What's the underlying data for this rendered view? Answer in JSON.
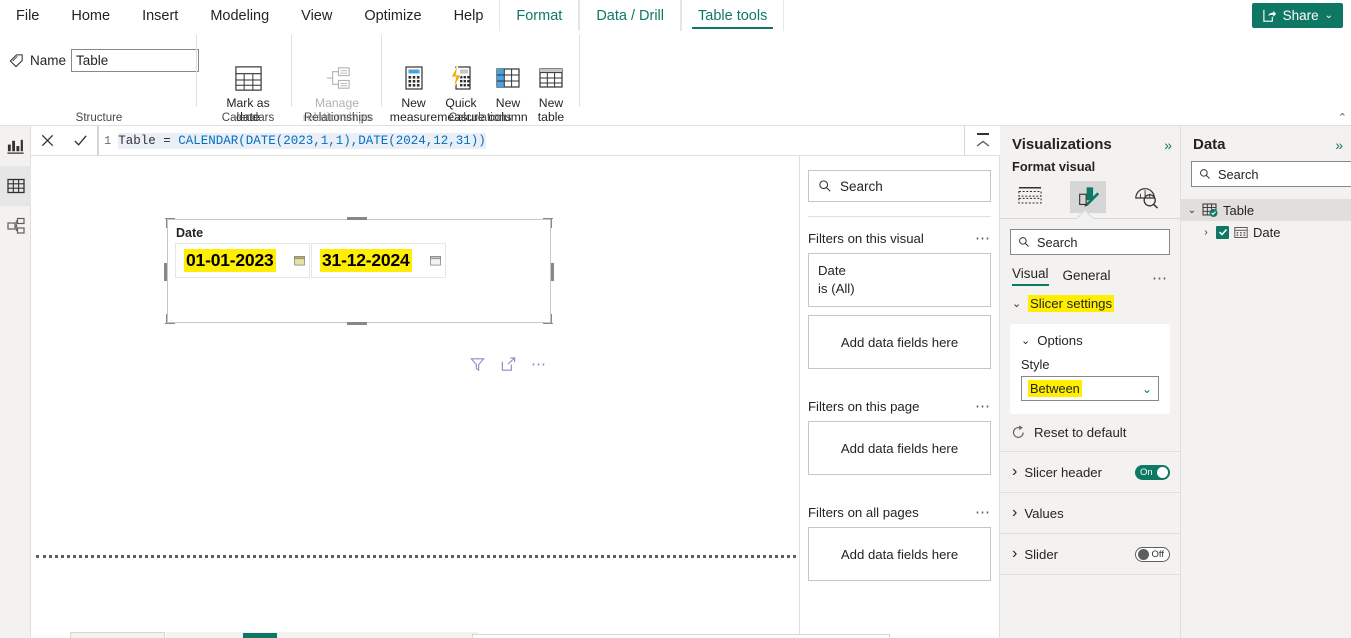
{
  "ribbon": {
    "tabs": [
      {
        "label": "File",
        "type": "normal",
        "active": false
      },
      {
        "label": "Home",
        "type": "normal",
        "active": false
      },
      {
        "label": "Insert",
        "type": "normal",
        "active": false
      },
      {
        "label": "Modeling",
        "type": "normal",
        "active": false
      },
      {
        "label": "View",
        "type": "normal",
        "active": false
      },
      {
        "label": "Optimize",
        "type": "normal",
        "active": false
      },
      {
        "label": "Help",
        "type": "normal",
        "active": false
      },
      {
        "label": "Format",
        "type": "contextual",
        "active": false
      },
      {
        "label": "Data / Drill",
        "type": "contextual",
        "active": false
      },
      {
        "label": "Table tools",
        "type": "contextual",
        "active": true
      }
    ],
    "share_label": "Share",
    "share_color": "#0f7864",
    "name_label": "Name",
    "name_value": "Table",
    "buttons": {
      "mark_as_date_table": "Mark as date\ntable ⌄",
      "manage_relationships": "Manage\nrelationships",
      "new_measure": "New\nmeasure",
      "quick_measure": "Quick\nmeasure",
      "new_column": "New\ncolumn",
      "new_table": "New\ntable"
    },
    "groups": {
      "structure": "Structure",
      "calendars": "Calendars",
      "relationships": "Relationships",
      "calculations": "Calculations"
    }
  },
  "formula_bar": {
    "line_number": "1",
    "name": "Table",
    "equals": " = ",
    "expression": "CALENDAR(DATE(2023,1,1),DATE(2024,12,31))",
    "full_text": "Table = CALENDAR(DATE(2023,1,1),DATE(2024,12,31))"
  },
  "canvas": {
    "slicer": {
      "title": "Date",
      "start_value": "01-01-2023",
      "end_value": "31-12-2024",
      "highlight_color": "#ffee00"
    }
  },
  "filters": {
    "search_placeholder": "Search",
    "sections": [
      {
        "title": "Filters on this visual",
        "cards": [
          {
            "field": "Date",
            "condition": "is (All)"
          }
        ],
        "dropzone": "Add data fields here"
      },
      {
        "title": "Filters on this page",
        "cards": [],
        "dropzone": "Add data fields here"
      },
      {
        "title": "Filters on all pages",
        "cards": [],
        "dropzone": "Add data fields here"
      }
    ]
  },
  "visualizations": {
    "title": "Visualizations",
    "format_visual_label": "Format visual",
    "search_placeholder": "Search",
    "tabs": [
      {
        "label": "Visual",
        "active": true
      },
      {
        "label": "General",
        "active": false
      }
    ],
    "slicer_settings_label": "Slicer settings",
    "options_label": "Options",
    "style_label": "Style",
    "style_value": "Between",
    "reset_label": "Reset to default",
    "toggles": [
      {
        "label": "Slicer header",
        "state": "On",
        "has_toggle": true
      },
      {
        "label": "Values",
        "state": "",
        "has_toggle": false
      },
      {
        "label": "Slider",
        "state": "Off",
        "has_toggle": true
      }
    ],
    "accent_color": "#0f7864"
  },
  "data_pane": {
    "title": "Data",
    "search_placeholder": "Search",
    "tree": [
      {
        "label": "Table",
        "level": 0,
        "selected": true,
        "checked": false
      },
      {
        "label": "Date",
        "level": 1,
        "selected": false,
        "checked": true
      }
    ]
  },
  "left_rail": [
    {
      "name": "report-view",
      "selected": false
    },
    {
      "name": "data-view",
      "selected": true
    },
    {
      "name": "model-view",
      "selected": false
    }
  ]
}
